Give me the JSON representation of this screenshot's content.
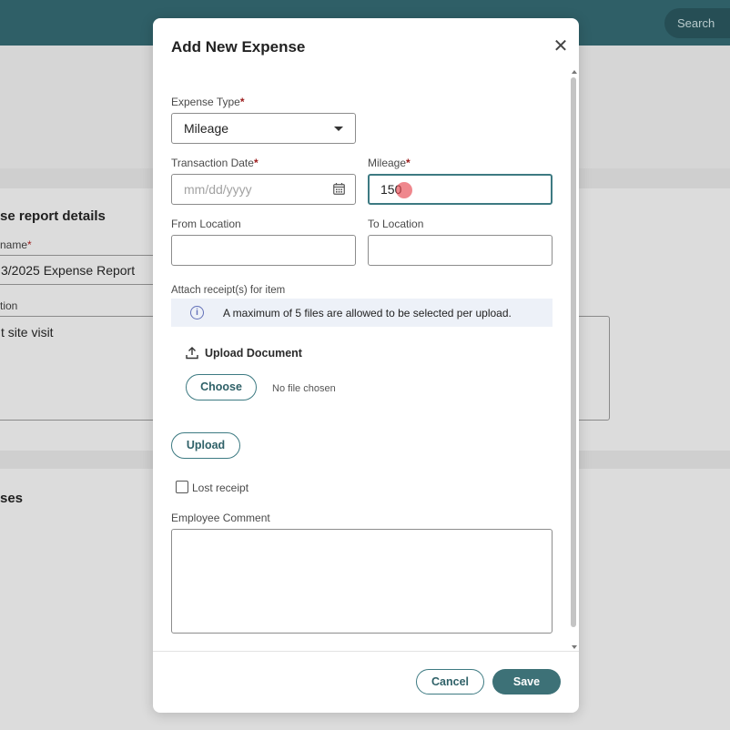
{
  "background": {
    "search_placeholder": "Search",
    "section_title": "se report details",
    "name_label": "name",
    "name_value": "3/2025 Expense Report",
    "description_label": "tion",
    "description_value": "t site visit",
    "expenses_title": "ses"
  },
  "modal": {
    "title": "Add New Expense",
    "close_icon": "close-icon",
    "expense_type": {
      "label": "Expense Type",
      "value": "Mileage"
    },
    "transaction_date": {
      "label": "Transaction Date",
      "placeholder": "mm/dd/yyyy"
    },
    "mileage": {
      "label": "Mileage",
      "value": "150"
    },
    "from_location": {
      "label": "From Location",
      "value": ""
    },
    "to_location": {
      "label": "To Location",
      "value": ""
    },
    "attach_label": "Attach receipt(s) for item",
    "info_message": "A maximum of 5 files are allowed to be selected per upload.",
    "upload_document_label": "Upload Document",
    "choose_label": "Choose",
    "no_file_text": "No file chosen",
    "upload_label": "Upload",
    "lost_receipt": {
      "label": "Lost receipt",
      "checked": false
    },
    "employee_comment_label": "Employee Comment",
    "cancel_label": "Cancel",
    "save_label": "Save"
  },
  "colors": {
    "topbar": "#2f5f67",
    "accent": "#3d7a82",
    "save_button": "#3d7177",
    "required_marker": "#9b1b1b",
    "info_bg": "#edf1f8"
  }
}
